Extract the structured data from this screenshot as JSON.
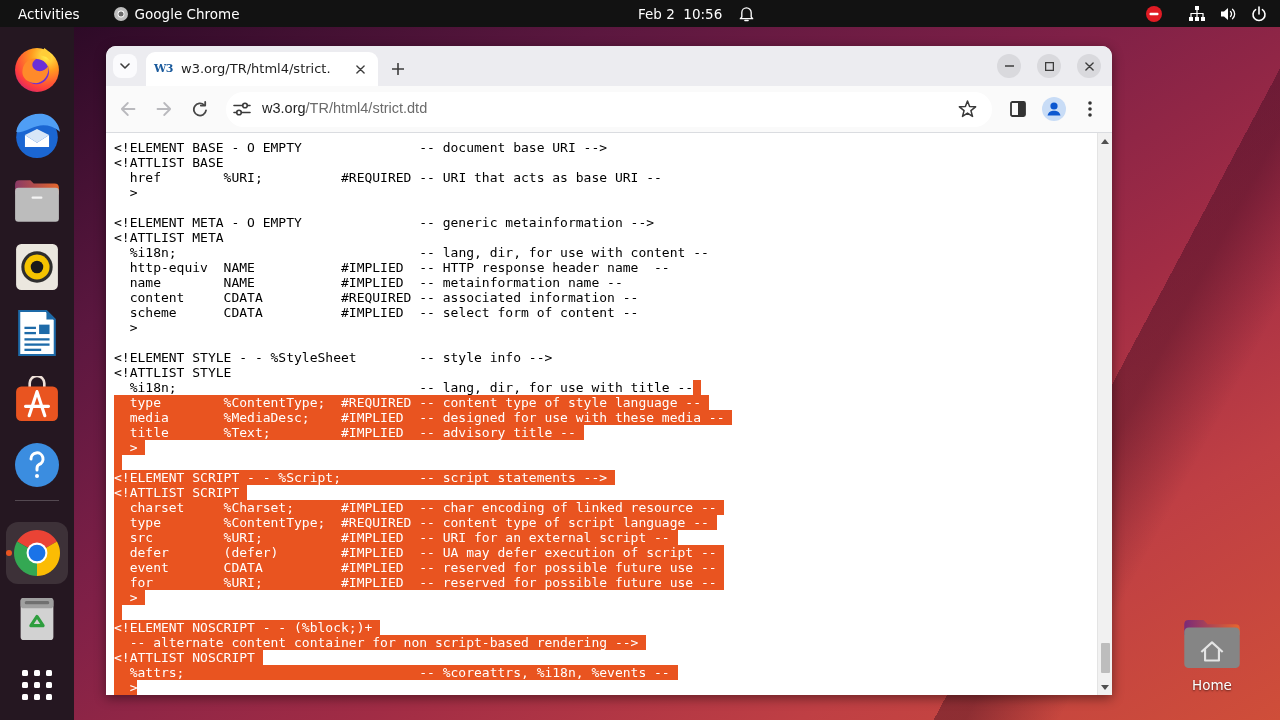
{
  "top_bar": {
    "activities": "Activities",
    "app_menu": "Google Chrome",
    "clock": "Feb 2  10:56"
  },
  "dock": {
    "items": [
      {
        "kind": "fox",
        "running": false
      },
      {
        "kind": "bird-mail",
        "running": false
      },
      {
        "kind": "folder",
        "running": false
      },
      {
        "kind": "speaker",
        "running": false
      },
      {
        "kind": "document",
        "running": false
      },
      {
        "kind": "bag",
        "running": false
      },
      {
        "kind": "help",
        "running": false
      },
      {
        "kind": "separator"
      },
      {
        "kind": "browser",
        "running": true
      },
      {
        "kind": "trash",
        "running": false
      },
      {
        "kind": "grid",
        "running": false
      }
    ]
  },
  "browser": {
    "tabs": [
      {
        "favicon": "W3",
        "title": "w3.org/TR/html4/strict.",
        "selected": true
      }
    ],
    "nav_buttons": [
      {
        "kind": "back",
        "disabled": true
      },
      {
        "kind": "forward",
        "disabled": true
      },
      {
        "kind": "reload",
        "disabled": false
      }
    ],
    "address_bar": {
      "host": "w3.org",
      "path": "/TR/html4/strict.dtd"
    },
    "document": {
      "lines": [
        {
          "kind": "code",
          "text": "<!ELEMENT BASE - O EMPTY               -- document base URI -->",
          "selected": false,
          "line_end_selected": false
        },
        {
          "kind": "code",
          "text": "<!ATTLIST BASE",
          "selected": false,
          "line_end_selected": false
        },
        {
          "kind": "code",
          "text": "  href        %URI;          #REQUIRED -- URI that acts as base URI --",
          "selected": false,
          "line_end_selected": false
        },
        {
          "kind": "code",
          "text": "  >",
          "selected": false,
          "line_end_selected": false
        },
        {
          "kind": "blank",
          "line_end_selected": false
        },
        {
          "kind": "code",
          "text": "<!ELEMENT META - O EMPTY               -- generic metainformation -->",
          "selected": false,
          "line_end_selected": false
        },
        {
          "kind": "code",
          "text": "<!ATTLIST META",
          "selected": false,
          "line_end_selected": false
        },
        {
          "kind": "code",
          "text": "  %i18n;                               -- lang, dir, for use with content --",
          "selected": false,
          "line_end_selected": false
        },
        {
          "kind": "code",
          "text": "  http-equiv  NAME           #IMPLIED  -- HTTP response header name  --",
          "selected": false,
          "line_end_selected": false
        },
        {
          "kind": "code",
          "text": "  name        NAME           #IMPLIED  -- metainformation name --",
          "selected": false,
          "line_end_selected": false
        },
        {
          "kind": "code",
          "text": "  content     CDATA          #REQUIRED -- associated information --",
          "selected": false,
          "line_end_selected": false
        },
        {
          "kind": "code",
          "text": "  scheme      CDATA          #IMPLIED  -- select form of content --",
          "selected": false,
          "line_end_selected": false
        },
        {
          "kind": "code",
          "text": "  >",
          "selected": false,
          "line_end_selected": false
        },
        {
          "kind": "blank",
          "line_end_selected": false
        },
        {
          "kind": "code",
          "text": "<!ELEMENT STYLE - - %StyleSheet        -- style info -->",
          "selected": false,
          "line_end_selected": false
        },
        {
          "kind": "code",
          "text": "<!ATTLIST STYLE",
          "selected": false,
          "line_end_selected": false
        },
        {
          "kind": "code",
          "text": "  %i18n;                               -- lang, dir, for use with title --",
          "selected": false,
          "line_end_selected": true
        },
        {
          "kind": "code",
          "text": "  type        %ContentType;  #REQUIRED -- content type of style language --",
          "selected": true,
          "line_end_selected": true
        },
        {
          "kind": "code",
          "text": "  media       %MediaDesc;    #IMPLIED  -- designed for use with these media --",
          "selected": true,
          "line_end_selected": true
        },
        {
          "kind": "code",
          "text": "  title       %Text;         #IMPLIED  -- advisory title --",
          "selected": true,
          "line_end_selected": true
        },
        {
          "kind": "code",
          "text": "  >",
          "selected": true,
          "line_end_selected": true
        },
        {
          "kind": "blank",
          "line_end_selected": true
        },
        {
          "kind": "code",
          "text": "<!ELEMENT SCRIPT - - %Script;          -- script statements -->",
          "selected": true,
          "line_end_selected": true
        },
        {
          "kind": "code",
          "text": "<!ATTLIST SCRIPT",
          "selected": true,
          "line_end_selected": true
        },
        {
          "kind": "code",
          "text": "  charset     %Charset;      #IMPLIED  -- char encoding of linked resource --",
          "selected": true,
          "line_end_selected": true
        },
        {
          "kind": "code",
          "text": "  type        %ContentType;  #REQUIRED -- content type of script language --",
          "selected": true,
          "line_end_selected": true
        },
        {
          "kind": "code",
          "text": "  src         %URI;          #IMPLIED  -- URI for an external script --",
          "selected": true,
          "line_end_selected": true
        },
        {
          "kind": "code",
          "text": "  defer       (defer)        #IMPLIED  -- UA may defer execution of script --",
          "selected": true,
          "line_end_selected": true
        },
        {
          "kind": "code",
          "text": "  event       CDATA          #IMPLIED  -- reserved for possible future use --",
          "selected": true,
          "line_end_selected": true
        },
        {
          "kind": "code",
          "text": "  for         %URI;          #IMPLIED  -- reserved for possible future use --",
          "selected": true,
          "line_end_selected": true
        },
        {
          "kind": "code",
          "text": "  >",
          "selected": true,
          "line_end_selected": true
        },
        {
          "kind": "blank",
          "line_end_selected": true
        },
        {
          "kind": "code",
          "text": "<!ELEMENT NOSCRIPT - - (%block;)+",
          "selected": true,
          "line_end_selected": true
        },
        {
          "kind": "code",
          "text": "  -- alternate content container for non script-based rendering -->",
          "selected": true,
          "line_end_selected": true
        },
        {
          "kind": "code",
          "text": "<!ATTLIST NOSCRIPT",
          "selected": true,
          "line_end_selected": true
        },
        {
          "kind": "code",
          "text": "  %attrs;                              -- %coreattrs, %i18n, %events --",
          "selected": true,
          "line_end_selected": true
        },
        {
          "kind": "code",
          "text": "  >",
          "selected": true,
          "line_end_selected": false
        }
      ]
    }
  },
  "desktop_icons": [
    {
      "kind": "home-folder",
      "label": "Home"
    }
  ]
}
